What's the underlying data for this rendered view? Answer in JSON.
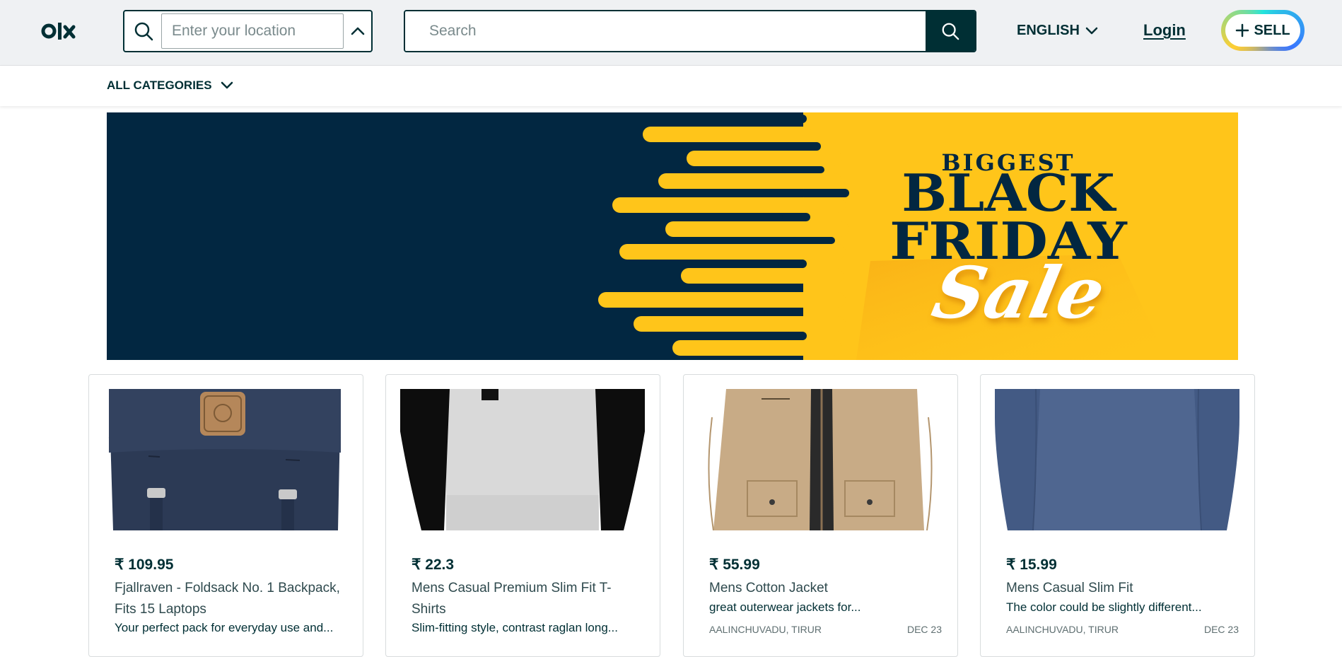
{
  "header": {
    "logo_text": "olx",
    "location_placeholder": "Enter your location",
    "search_placeholder": "Search",
    "language_label": "ENGLISH",
    "login_label": "Login",
    "sell_label": "SELL"
  },
  "nav": {
    "all_categories_label": "ALL CATEGORIES"
  },
  "banner": {
    "line1": "BIGGEST",
    "line2": "BLACK",
    "line3": "FRIDAY",
    "line4": "Sale"
  },
  "products": [
    {
      "price": "₹ 109.95",
      "title": "Fjallraven - Foldsack No. 1 Backpack, Fits 15 Laptops",
      "description": "Your perfect pack for everyday use and...",
      "location": "",
      "date": ""
    },
    {
      "price": "₹ 22.3",
      "title": "Mens Casual Premium Slim Fit T-Shirts",
      "description": "Slim-fitting style, contrast raglan long...",
      "location": "",
      "date": ""
    },
    {
      "price": "₹ 55.99",
      "title": "Mens Cotton Jacket",
      "description": "great outerwear jackets for...",
      "location": "AALINCHUVADU, TIRUR",
      "date": "DEC 23"
    },
    {
      "price": "₹ 15.99",
      "title": "Mens Casual Slim Fit",
      "description": "The color could be slightly different...",
      "location": "AALINCHUVADU, TIRUR",
      "date": "DEC 23"
    }
  ],
  "colors": {
    "brand_dark": "#002f34",
    "banner_navy": "#022741",
    "banner_yellow": "#ffc51a"
  }
}
